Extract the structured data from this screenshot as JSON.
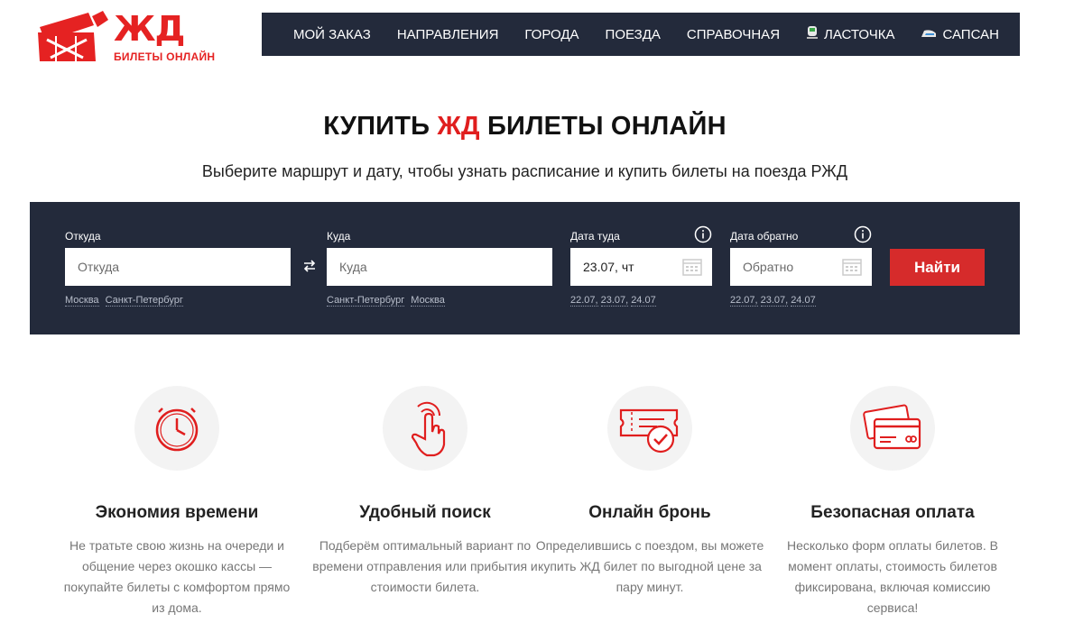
{
  "logo": {
    "mark": "ЖД",
    "tagline": "БИЛЕТЫ ОНЛАЙН"
  },
  "nav": {
    "items": [
      {
        "label": "МОЙ ЗАКАЗ"
      },
      {
        "label": "НАПРАВЛЕНИЯ"
      },
      {
        "label": "ГОРОДА"
      },
      {
        "label": "ПОЕЗДА"
      },
      {
        "label": "СПРАВОЧНАЯ"
      },
      {
        "label": "ЛАСТОЧКА",
        "icon": "train-swallow-icon"
      },
      {
        "label": "САПСАН",
        "icon": "train-sapsan-icon"
      }
    ]
  },
  "hero": {
    "title_before": "КУПИТЬ ",
    "title_accent": "ЖД",
    "title_after": " БИЛЕТЫ ОНЛАЙН",
    "subtitle": "Выберите маршрут и дату, чтобы узнать расписание и купить билеты на поезда РЖД"
  },
  "search": {
    "from": {
      "label": "Откуда",
      "placeholder": "Откуда",
      "value": "",
      "quick": [
        "Москва",
        "Санкт-Петербург"
      ]
    },
    "to": {
      "label": "Куда",
      "placeholder": "Куда",
      "value": "",
      "quick": [
        "Санкт-Петербург",
        "Москва"
      ]
    },
    "date_there": {
      "label": "Дата туда",
      "value": "23.07, чт",
      "quick": [
        "22.07,",
        "23.07,",
        "24.07"
      ]
    },
    "date_back": {
      "label": "Дата обратно",
      "placeholder": "Обратно",
      "value": "",
      "quick": [
        "22.07,",
        "23.07,",
        "24.07"
      ]
    },
    "submit_label": "Найти",
    "swap_icon": "swap-arrows-icon"
  },
  "features": [
    {
      "icon": "clock-icon",
      "title": "Экономия времени",
      "text": "Не тратьте свою жизнь на очереди и общение через окошко кассы — покупайте билеты с комфортом прямо из дома."
    },
    {
      "icon": "hand-pointer-icon",
      "title": "Удобный поиск",
      "text": "Подберём оптимальный вариант по времени отправления или прибытия и стоимости билета."
    },
    {
      "icon": "ticket-check-icon",
      "title": "Онлайн бронь",
      "text": "Определившись с поездом, вы можете купить ЖД билет по выгодной цене за пару минут."
    },
    {
      "icon": "credit-cards-icon",
      "title": "Безопасная оплата",
      "text": "Несколько форм оплаты билетов. В момент оплаты, стоимость билетов фиксирована, включая комиссию сервиса!"
    }
  ],
  "colors": {
    "accent": "#e01e1e",
    "nav_bg": "#232a3b",
    "button": "#d62b2b"
  }
}
